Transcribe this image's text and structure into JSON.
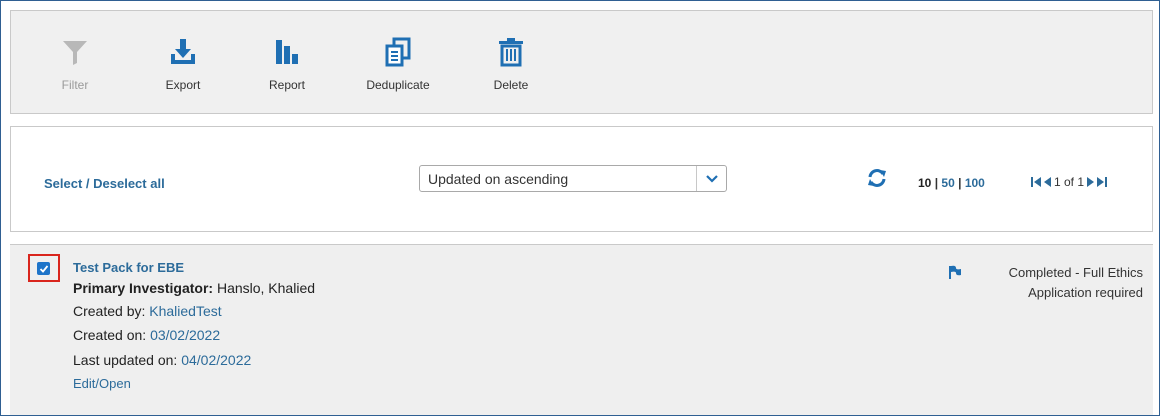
{
  "toolbar": {
    "filter_label": "Filter",
    "export_label": "Export",
    "report_label": "Report",
    "deduplicate_label": "Deduplicate",
    "delete_label": "Delete"
  },
  "list_controls": {
    "select_all_label": "Select / Deselect all",
    "sort_value": "Updated on ascending",
    "page_sizes": [
      "10",
      "50",
      "100"
    ],
    "page_separator": "|",
    "current_page_size": "10",
    "pager_text": "1 of 1"
  },
  "result": {
    "checked": true,
    "title": "Test Pack for EBE",
    "pi_label": "Primary Investigator:",
    "pi_value": "Hanslo, Khalied",
    "created_by_label": "Created by:",
    "created_by_value": "KhaliedTest",
    "created_on_label": "Created on:",
    "created_on_value": "03/02/2022",
    "updated_label": "Last updated on:",
    "updated_value": "04/02/2022",
    "edit_label": "Edit/Open",
    "status_line1": "Completed - Full Ethics",
    "status_line2": "Application required"
  },
  "colors": {
    "accent": "#1f6fb3",
    "link": "#2c6b9a",
    "highlight": "#d9251d"
  }
}
